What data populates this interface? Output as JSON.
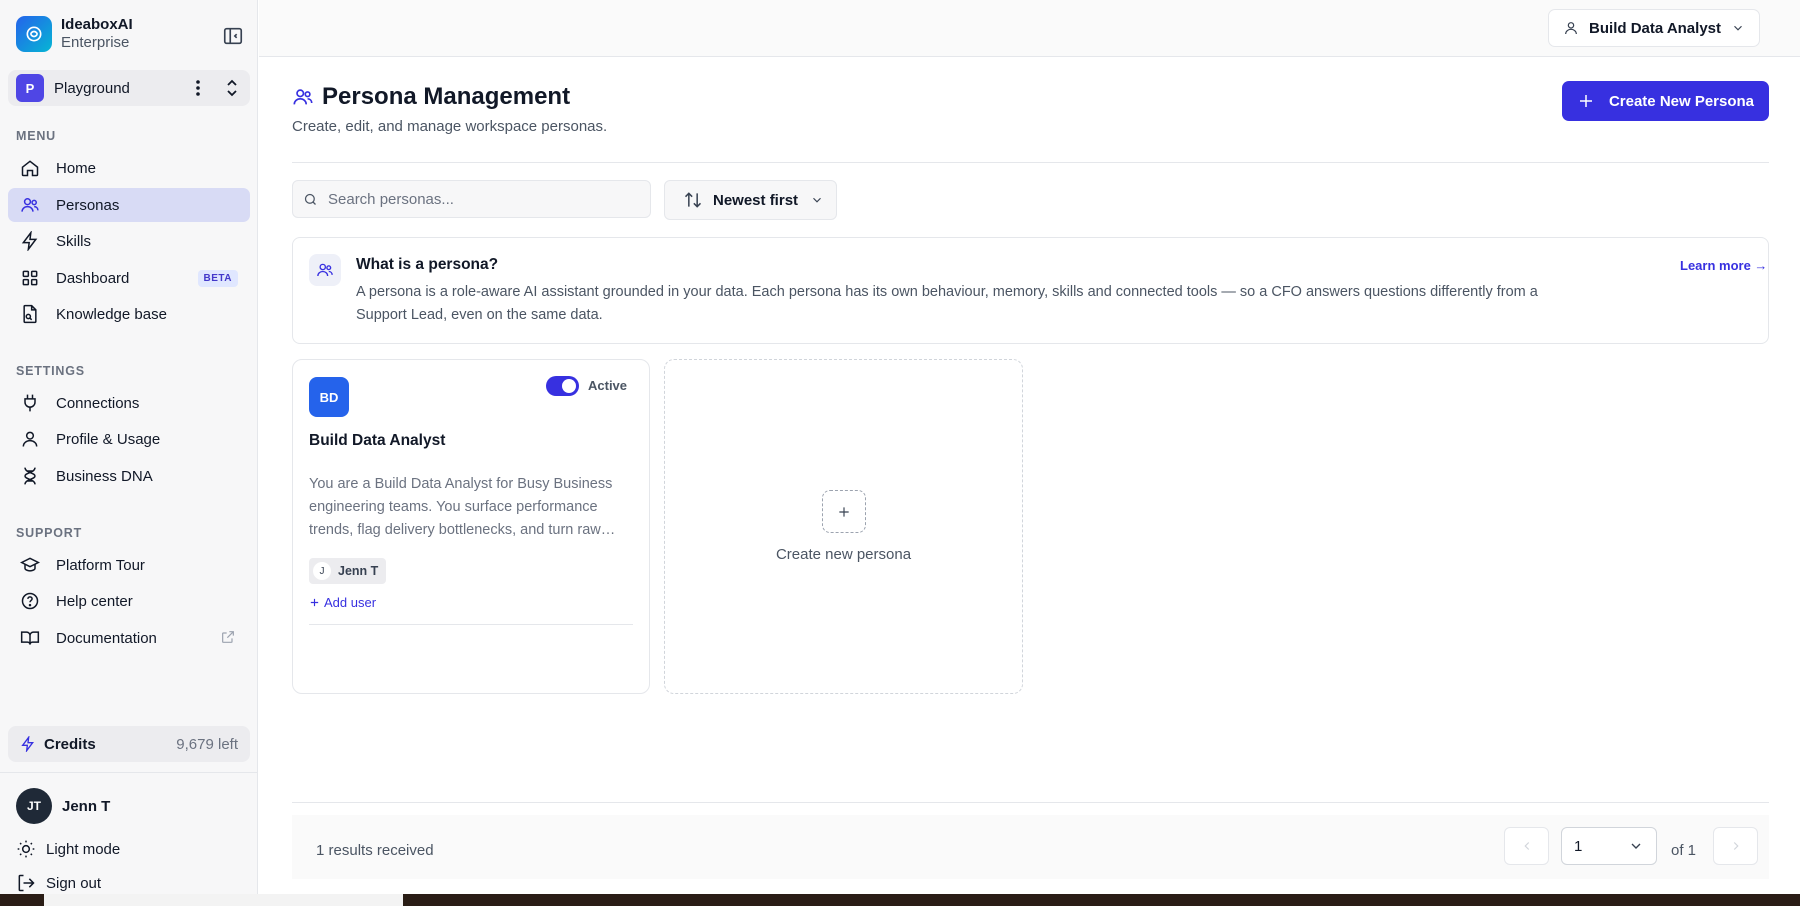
{
  "brand": {
    "name": "IdeaboxAI",
    "plan": "Enterprise"
  },
  "workspace": {
    "initial": "P",
    "name": "Playground"
  },
  "sidebar": {
    "menu_label": "MENU",
    "menu": [
      {
        "label": "Home"
      },
      {
        "label": "Personas"
      },
      {
        "label": "Skills"
      },
      {
        "label": "Dashboard",
        "badge": "BETA"
      },
      {
        "label": "Knowledge base"
      }
    ],
    "settings_label": "SETTINGS",
    "settings": [
      {
        "label": "Connections"
      },
      {
        "label": "Profile & Usage"
      },
      {
        "label": "Business DNA"
      }
    ],
    "support_label": "SUPPORT",
    "support": [
      {
        "label": "Platform Tour"
      },
      {
        "label": "Help center"
      },
      {
        "label": "Documentation"
      }
    ],
    "credits": {
      "label": "Credits",
      "left": "9,679 left"
    },
    "user": {
      "initials": "JT",
      "name": "Jenn T"
    },
    "light_mode": "Light mode",
    "sign_out": "Sign out"
  },
  "topbar": {
    "active_persona": "Build Data Analyst"
  },
  "page": {
    "title": "Persona Management",
    "subtitle": "Create, edit, and manage workspace personas.",
    "create_button": "Create New Persona"
  },
  "filters": {
    "search_placeholder": "Search personas...",
    "sort": "Newest first"
  },
  "info": {
    "title": "What is a persona?",
    "body": "A persona is a role-aware AI assistant grounded in your data. Each persona has its own behaviour, memory, skills and connected tools — so a CFO answers questions differently from a Support Lead, even on the same data.",
    "learn_more": "Learn more →"
  },
  "personas": [
    {
      "initials": "BD",
      "name": "Build Data Analyst",
      "status": "Active",
      "description": "You are a Build Data Analyst for Busy Business engineering teams. You surface performance trends, flag delivery bottlenecks, and turn raw…",
      "user": {
        "initial": "J",
        "name": "Jenn T"
      },
      "add_user": "Add user"
    }
  ],
  "create_card": {
    "label": "Create new persona"
  },
  "pagination": {
    "results": "1 results received",
    "page": "1",
    "of": "of 1"
  },
  "colors": {
    "accent": "#3730e0",
    "active_nav": "#d8dbf5",
    "avatar": "#2563eb"
  }
}
